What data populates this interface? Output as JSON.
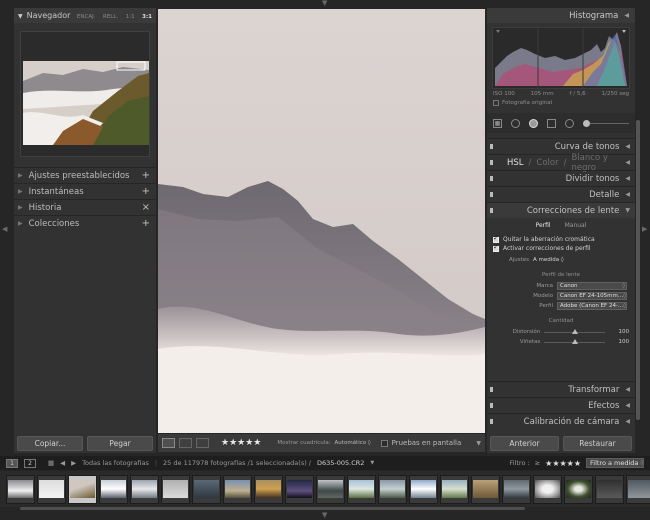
{
  "left": {
    "navigator": {
      "title": "Navegador",
      "options": [
        "ENCAJ.",
        "RELL.",
        "1:1",
        "3:1"
      ],
      "active_option": "3:1"
    },
    "sections": [
      {
        "label": "Ajustes preestablecidos",
        "action": "+"
      },
      {
        "label": "Instantáneas",
        "action": "+"
      },
      {
        "label": "Historia",
        "action": "×"
      },
      {
        "label": "Colecciones",
        "action": "+"
      }
    ],
    "copy_label": "Copiar...",
    "paste_label": "Pegar"
  },
  "toolbar": {
    "stars": "★★★★★",
    "grid_label": "Mostrar cuadrícula:",
    "grid_value": "Automático ◊",
    "proof_label": "Pruebas en pantalla"
  },
  "right": {
    "histogram": {
      "title": "Histograma",
      "iso": "ISO 100",
      "focal": "105 mm",
      "aperture": "f / 5,6",
      "shutter": "1/250 seg",
      "original_label": "Fotografía original"
    },
    "sections": {
      "tone_curve": "Curva de tonos",
      "hsl": "HSL",
      "color": "Color",
      "bw": "Blanco y negro",
      "split": "Dividir tonos",
      "detail": "Detalle",
      "lens": "Correcciones de lente",
      "transform": "Transformar",
      "effects": "Efectos",
      "calibration": "Calibración de cámara"
    },
    "lens": {
      "tab_profile": "Perfil",
      "tab_manual": "Manual",
      "chk_ca": "Quitar la aberración cromática",
      "chk_profile": "Activar correcciones de perfil",
      "setup_label": "Ajustes",
      "setup_value": "A medida ◊",
      "profile_header": "Perfil de lente",
      "make_label": "Marca",
      "make_value": "Canon",
      "model_label": "Modelo",
      "model_value": "Canon EF 24-105mm...",
      "profile_label": "Perfil",
      "profile_value": "Adobe (Canon EF 24-...",
      "amount_header": "Cantidad",
      "distortion_label": "Distorsión",
      "distortion_value": "100",
      "vignetting_label": "Viñetas",
      "vignetting_value": "100"
    },
    "prev_label": "Anterior",
    "reset_label": "Restaurar"
  },
  "filmbar": {
    "mon1": "1",
    "mon2": "2",
    "source": "Todas las fotografías",
    "count": "25 de 117978 fotografías /1 seleccionada(s) /",
    "filename": "D635-005.CR2",
    "filter_label": "Filtro :",
    "filter_op": "≥",
    "filter_stars": "★★★★★",
    "filter_select": "Filtro a medida"
  },
  "accent": "#e8e8e8"
}
